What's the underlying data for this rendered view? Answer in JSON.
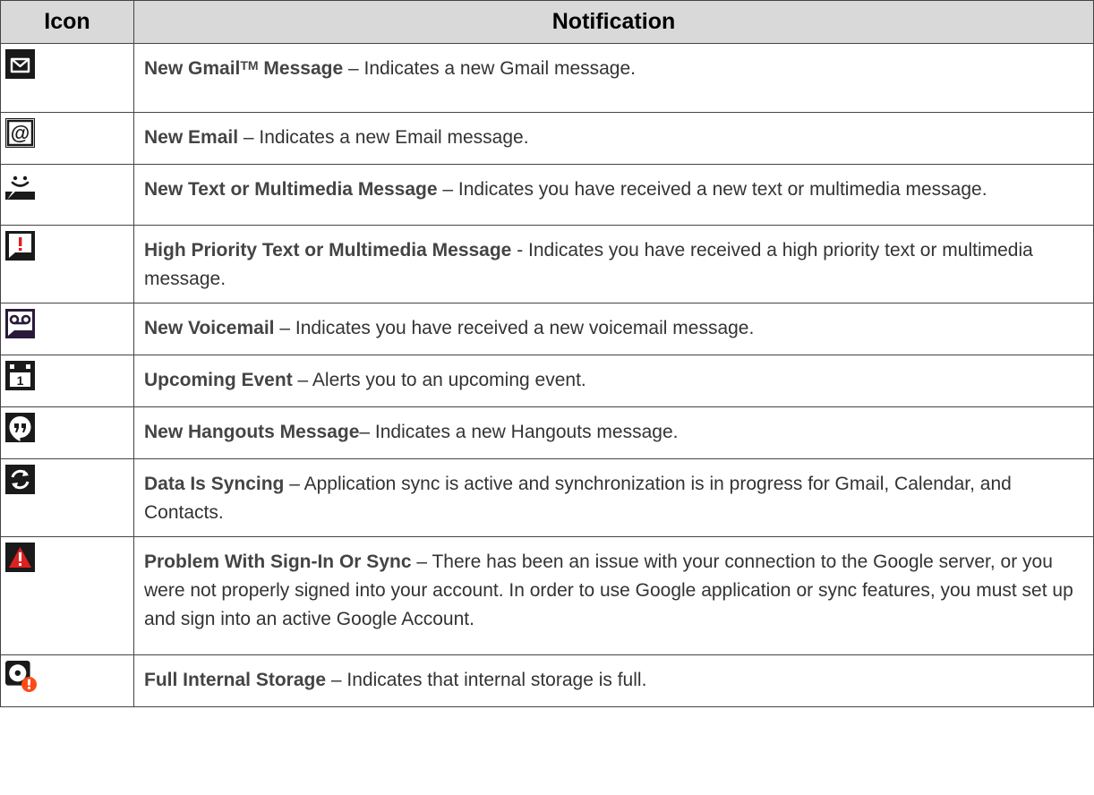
{
  "table": {
    "headers": {
      "icon": "Icon",
      "notification": "Notification"
    },
    "rows": [
      {
        "icon": "gmail-icon",
        "title": "New Gmail",
        "title_sup": "TM",
        "title_suffix": " Message",
        "separator": " – ",
        "description": "Indicates a new Gmail message."
      },
      {
        "icon": "email-at-icon",
        "title": "New Email",
        "separator": " – ",
        "description": "Indicates a new Email message."
      },
      {
        "icon": "message-smiley-icon",
        "title": "New Text or Multimedia Message",
        "separator": " – ",
        "description": "Indicates you have received a new text or multimedia message."
      },
      {
        "icon": "priority-message-icon",
        "title": "High Priority Text or Multimedia Message",
        "separator": " - ",
        "description": "Indicates you have received a high priority text or multimedia message."
      },
      {
        "icon": "voicemail-icon",
        "title": "New Voicemail",
        "separator": " – ",
        "description": "Indicates you have received a new voicemail message."
      },
      {
        "icon": "calendar-icon",
        "title": "Upcoming Event",
        "separator": " – ",
        "description": "Alerts you to an upcoming event."
      },
      {
        "icon": "hangouts-icon",
        "title": "New Hangouts Message",
        "separator": "– ",
        "description": "Indicates a new Hangouts message."
      },
      {
        "icon": "sync-icon",
        "title": "Data Is Syncing",
        "separator": " – ",
        "description": "Application sync is active and synchronization is in progress for Gmail, Calendar, and Contacts."
      },
      {
        "icon": "warning-icon",
        "title": "Problem With Sign-In Or Sync",
        "separator": " – ",
        "description": "There has been an issue with your connection to the Google server, or you were not properly signed into your account. In order to use Google application or sync features, you must set up and sign into an active Google Account."
      },
      {
        "icon": "storage-full-icon",
        "title": "Full Internal Storage",
        "separator": " – ",
        "description": "Indicates that internal storage is full."
      }
    ]
  },
  "colors": {
    "header_bg": "#d9d9d9",
    "border": "#444444",
    "icon_dark": "#1a1a1a",
    "alert_red": "#e02020",
    "alert_orange": "#ff4a1a"
  }
}
